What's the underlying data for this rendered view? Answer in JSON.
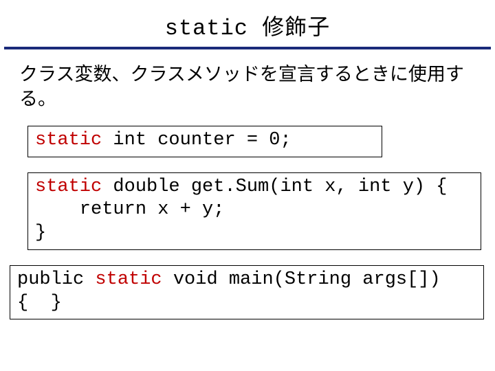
{
  "title": {
    "keyword": "static",
    "rest": " 修飾子"
  },
  "description": "クラス変数、クラスメソッドを宣言するときに使用する。",
  "code1": {
    "kw": "static",
    "rest": " int counter = 0;"
  },
  "code2": {
    "kw": "static",
    "line1_rest": " double get.Sum(int x, int y) {",
    "line2": "    return x + y;",
    "line3": "}"
  },
  "code3": {
    "pre": "public ",
    "kw": "static",
    "post": " void main(String args[])",
    "line2": "{  }"
  }
}
